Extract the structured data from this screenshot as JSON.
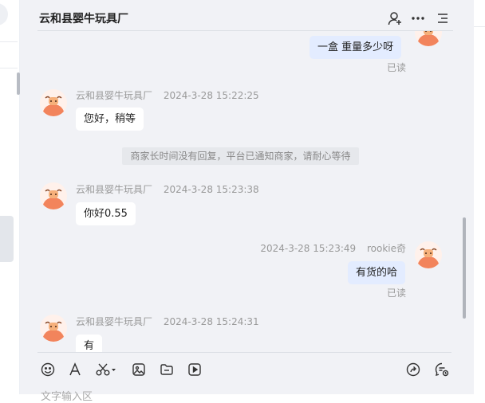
{
  "chat": {
    "title": "云和县婴牛玩具厂"
  },
  "messages": {
    "m1": {
      "text": "一盒  重量多少呀",
      "read": "已读"
    },
    "m2": {
      "sender": "云和县婴牛玩具厂",
      "time": "2024-3-28 15:22:25",
      "text": "您好，稍等"
    },
    "system": {
      "text": "商家长时间没有回复，平台已通知商家，请耐心等待"
    },
    "m3": {
      "sender": "云和县婴牛玩具厂",
      "time": "2024-3-28 15:23:38",
      "text": "你好0.55"
    },
    "m4": {
      "sender": "rookie奇",
      "time": "2024-3-28 15:23:49",
      "text": "有货的哈",
      "read": "已读"
    },
    "m5": {
      "sender": "云和县婴牛玩具厂",
      "time": "2024-3-28 15:24:31",
      "text": "有"
    }
  },
  "input": {
    "placeholder": "文字输入区"
  },
  "colors": {
    "panel_bg": "#f1f2f6",
    "outgoing_bubble": "#e3ecff",
    "incoming_bubble": "#ffffff",
    "avatar_accent": "#f2845c"
  }
}
